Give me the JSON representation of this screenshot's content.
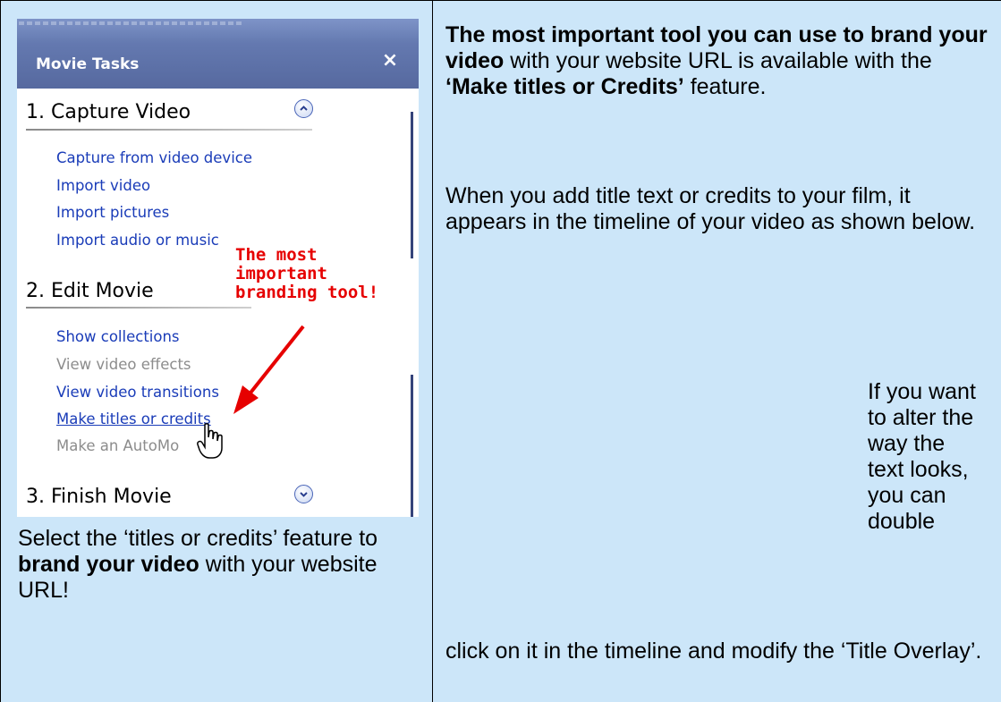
{
  "panel": {
    "title": "Movie Tasks",
    "close_label": "×",
    "sections": [
      {
        "title": "1. Capture Video",
        "toggle_icon": "chevron-up-icon",
        "items": [
          {
            "label": "Capture from video device",
            "state": "enabled"
          },
          {
            "label": "Import video",
            "state": "enabled"
          },
          {
            "label": "Import pictures",
            "state": "enabled"
          },
          {
            "label": "Import audio or music",
            "state": "enabled"
          }
        ]
      },
      {
        "title": "2. Edit Movie",
        "items": [
          {
            "label": "Show collections",
            "state": "enabled"
          },
          {
            "label": "View video effects",
            "state": "disabled"
          },
          {
            "label": "View video transitions",
            "state": "enabled"
          },
          {
            "label": "Make titles or credits",
            "state": "hover"
          },
          {
            "label": "Make an AutoMo",
            "state": "disabled"
          }
        ]
      },
      {
        "title": "3. Finish Movie",
        "toggle_icon": "chevron-down-icon"
      }
    ],
    "annotation": "The most\nimportant\nbranding tool!",
    "annotation_color": "#e60000"
  },
  "left_caption": {
    "part1": "Select the ‘titles or credits’ feature to ",
    "bold": "brand your video",
    "part2": " with your website URL!"
  },
  "right": {
    "p1_bold1": "The most important tool you can use to brand your video",
    "p1_text1": " with your website URL is available with the ",
    "p1_bold2": "‘Make titles or Credits’",
    "p1_text2": " feature.",
    "p2": "When you add title text or credits to your film, it appears in the timeline of your video as shown below.",
    "p3_narrow": "If you want to alter the way the text looks, you can double",
    "p3_wide": "click on it in the timeline and modify the ‘Title Overlay’."
  },
  "colors": {
    "page_bg": "#cce6f9",
    "panel_header": "#6479b0",
    "link": "#1a3cb8"
  }
}
